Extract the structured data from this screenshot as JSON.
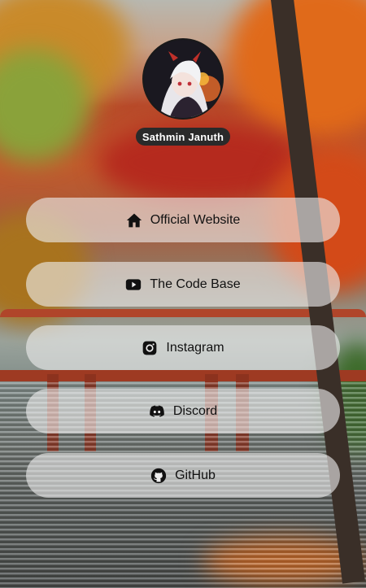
{
  "profile": {
    "name": "Sathmin Januth"
  },
  "links": [
    {
      "label": "Official Website",
      "icon": "home-icon"
    },
    {
      "label": "The Code Base",
      "icon": "youtube-icon"
    },
    {
      "label": "Instagram",
      "icon": "instagram-icon"
    },
    {
      "label": "Discord",
      "icon": "discord-icon"
    },
    {
      "label": "GitHub",
      "icon": "github-icon"
    }
  ],
  "colors": {
    "button_bg": "rgba(238,238,238,0.62)",
    "badge_bg": "#2a2a2a",
    "text": "#111111"
  }
}
